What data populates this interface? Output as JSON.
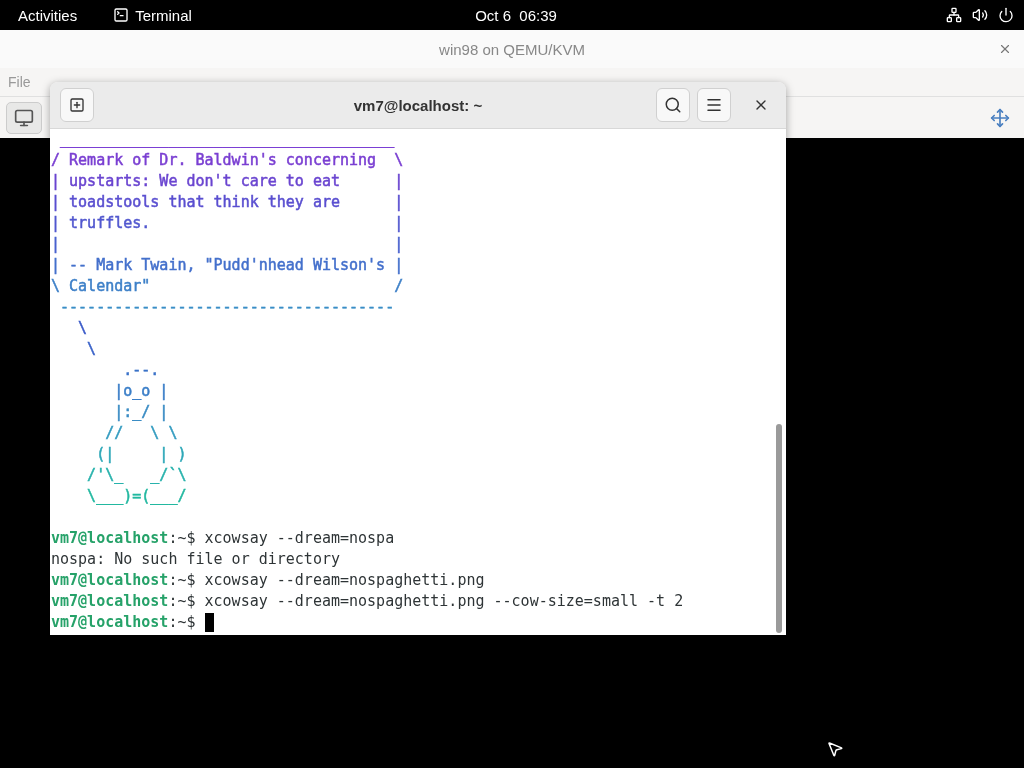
{
  "top_bar": {
    "activities": "Activities",
    "app": "Terminal",
    "clock": "Oct 6  06:39"
  },
  "vm_window": {
    "title": "win98 on QEMU/KVM",
    "menu": [
      "File"
    ]
  },
  "terminal": {
    "title": "vm7@localhost: ~",
    "lines": [
      {
        "kind": "art",
        "text": " _____________________________________",
        "color": "#7b3fd4"
      },
      {
        "kind": "art",
        "text": "/ Remark of Dr. Baldwin's concerning  \\",
        "color": "#7a3fd2"
      },
      {
        "kind": "art",
        "text": "| upstarts: We don't care to eat      |",
        "color": "#6a45d0"
      },
      {
        "kind": "art",
        "text": "| toadstools that think they are      |",
        "color": "#5a4fd0"
      },
      {
        "kind": "art",
        "text": "| truffles.                           |",
        "color": "#5258cf"
      },
      {
        "kind": "art",
        "text": "|                                     |",
        "color": "#4a62cf"
      },
      {
        "kind": "art",
        "text": "| -- Mark Twain, \"Pudd'nhead Wilson's |",
        "color": "#4470cc"
      },
      {
        "kind": "art",
        "text": "\\ Calendar\"                           /",
        "color": "#3e80c8"
      },
      {
        "kind": "art",
        "text": " -------------------------------------",
        "color": "#3a8ec6"
      },
      {
        "kind": "art",
        "text": "   \\",
        "color": "#3a5ac8"
      },
      {
        "kind": "art",
        "text": "    \\",
        "color": "#3a62c8"
      },
      {
        "kind": "art",
        "text": "        .--.",
        "color": "#3a72c8"
      },
      {
        "kind": "art",
        "text": "       |o_o |",
        "color": "#3a7ec8"
      },
      {
        "kind": "art",
        "text": "       |:_/ |",
        "color": "#3a8cc4"
      },
      {
        "kind": "art",
        "text": "      //   \\ \\",
        "color": "#349cc0"
      },
      {
        "kind": "art",
        "text": "     (|     | )",
        "color": "#2ea8b8"
      },
      {
        "kind": "art",
        "text": "    /'\\_   _/`\\",
        "color": "#28b2ac"
      },
      {
        "kind": "art",
        "text": "    \\___)=(___/",
        "color": "#22b8a0"
      },
      {
        "kind": "blank"
      },
      {
        "kind": "prompt",
        "user": "vm7@localhost",
        "text": ":~$ xcowsay --dream=nospa",
        "cursor": false
      },
      {
        "kind": "output",
        "text": "nospa: No such file or directory"
      },
      {
        "kind": "prompt",
        "user": "vm7@localhost",
        "text": ":~$ xcowsay --dream=nospaghetti.png",
        "cursor": false
      },
      {
        "kind": "prompt",
        "user": "vm7@localhost",
        "text": ":~$ xcowsay --dream=nospaghetti.png --cow-size=small -t 2",
        "cursor": false
      },
      {
        "kind": "prompt",
        "user": "vm7@localhost",
        "text": ":~$",
        "cursor": true
      }
    ]
  }
}
